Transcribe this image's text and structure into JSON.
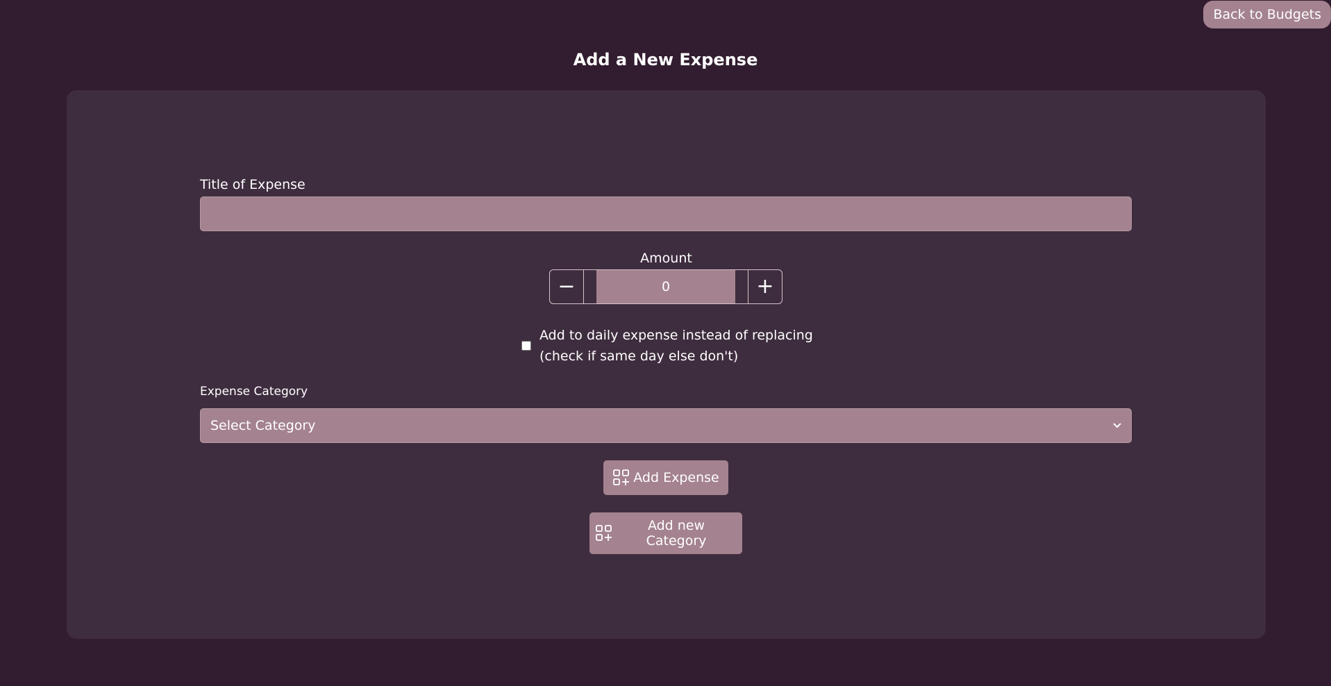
{
  "header": {
    "back_label": "Back to Budgets",
    "title": "Add a New Expense"
  },
  "form": {
    "title_label": "Title of Expense",
    "title_value": "",
    "amount_label": "Amount",
    "amount_value": "0",
    "minus_symbol": "−",
    "plus_symbol": "+",
    "checkbox_line1": "Add to daily expense instead of replacing",
    "checkbox_line2": "(check if same day else don't)",
    "checkbox_checked": false,
    "category_label": "Expense Category",
    "category_selected": "Select Category",
    "add_expense_label": "Add Expense",
    "add_category_label": "Add new Category"
  },
  "icons": {
    "back": "none",
    "add_expense": "grid-plus-icon",
    "add_category": "grid-plus-icon",
    "select": "chevron-down-icon"
  },
  "colors": {
    "background": "#321c2f",
    "card": "#3e2d3e",
    "accent": "#a4828f",
    "text": "#ffffff"
  }
}
